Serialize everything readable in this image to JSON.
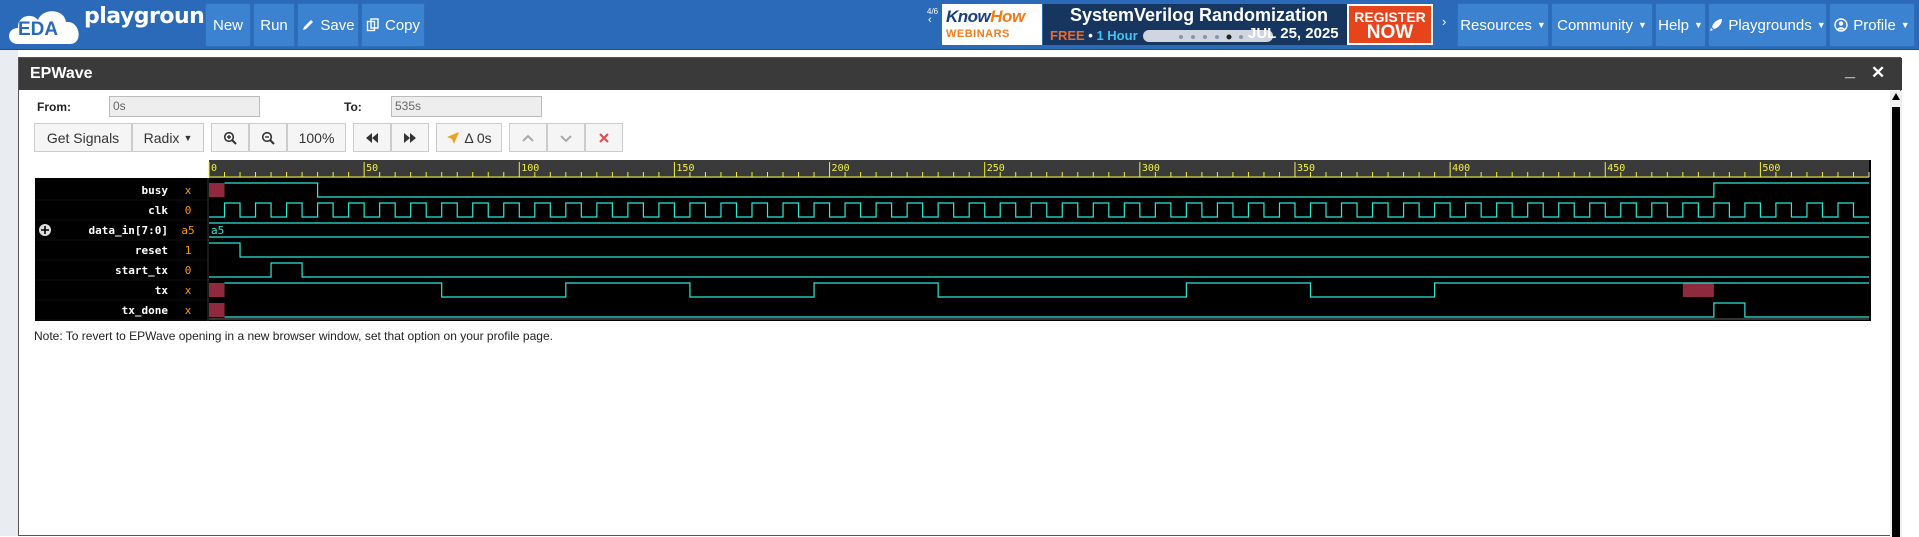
{
  "navbar": {
    "logo_eda": "EDA",
    "logo_text": "playground",
    "buttons": {
      "new": "New",
      "run": "Run",
      "save": "Save",
      "copy": "Copy"
    },
    "promo": {
      "nav_counter": "4/6",
      "knowhow_a": "Know",
      "knowhow_b": "How",
      "webinars": "WEBINARS",
      "title": "SystemVerilog Randomization",
      "free": "FREE",
      "duration": "1 Hour",
      "date": "JUL 25, 2025",
      "register_top": "REGISTER",
      "register_bottom": "NOW"
    },
    "menus": {
      "resources": "Resources",
      "community": "Community",
      "help": "Help",
      "playgrounds": "Playgrounds",
      "profile": "Profile"
    }
  },
  "epwave": {
    "title": "EPWave",
    "from_label": "From:",
    "from_value": "0s",
    "to_label": "To:",
    "to_value": "535s",
    "toolbar": {
      "get_signals": "Get Signals",
      "radix": "Radix",
      "zoom": "100%",
      "delta": "Δ 0s"
    },
    "note": "Note: To revert to EPWave opening in a new browser window, set that option on your profile page."
  },
  "waveform": {
    "time_start": 0,
    "time_end": 535,
    "tick_labels": [
      "0",
      "50",
      "100",
      "150",
      "200",
      "250",
      "300",
      "350",
      "400",
      "450",
      "500"
    ],
    "signals": [
      {
        "name": "busy",
        "value": "x"
      },
      {
        "name": "clk",
        "value": "0"
      },
      {
        "name": "data_in[7:0]",
        "value": "a5",
        "bus_label": "a5"
      },
      {
        "name": "reset",
        "value": "1"
      },
      {
        "name": "start_tx",
        "value": "0"
      },
      {
        "name": "tx",
        "value": "x"
      },
      {
        "name": "tx_done",
        "value": "x"
      }
    ],
    "colors": {
      "signal": "#2ee8d8",
      "xfill": "#8f2a3e",
      "ruler": "#f2f23a",
      "value": "#ff9900"
    }
  }
}
